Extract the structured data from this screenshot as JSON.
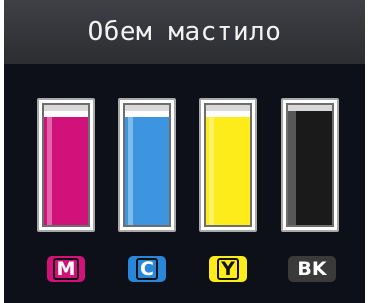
{
  "header": {
    "title": "Обем мастило"
  },
  "cartridges": [
    {
      "label": "M",
      "color": "#d2127b",
      "level": 0.95
    },
    {
      "label": "C",
      "color": "#3d95e0",
      "level": 0.95
    },
    {
      "label": "Y",
      "color": "#fdeb1a",
      "level": 0.95
    },
    {
      "label": "BK",
      "color": "#1a1a1a",
      "level": 1.0
    }
  ],
  "badge_colors": {
    "M": "#d2127b",
    "C": "#2a86d8",
    "Y": "#fdeb1a",
    "BK": "#3a3a3a"
  }
}
